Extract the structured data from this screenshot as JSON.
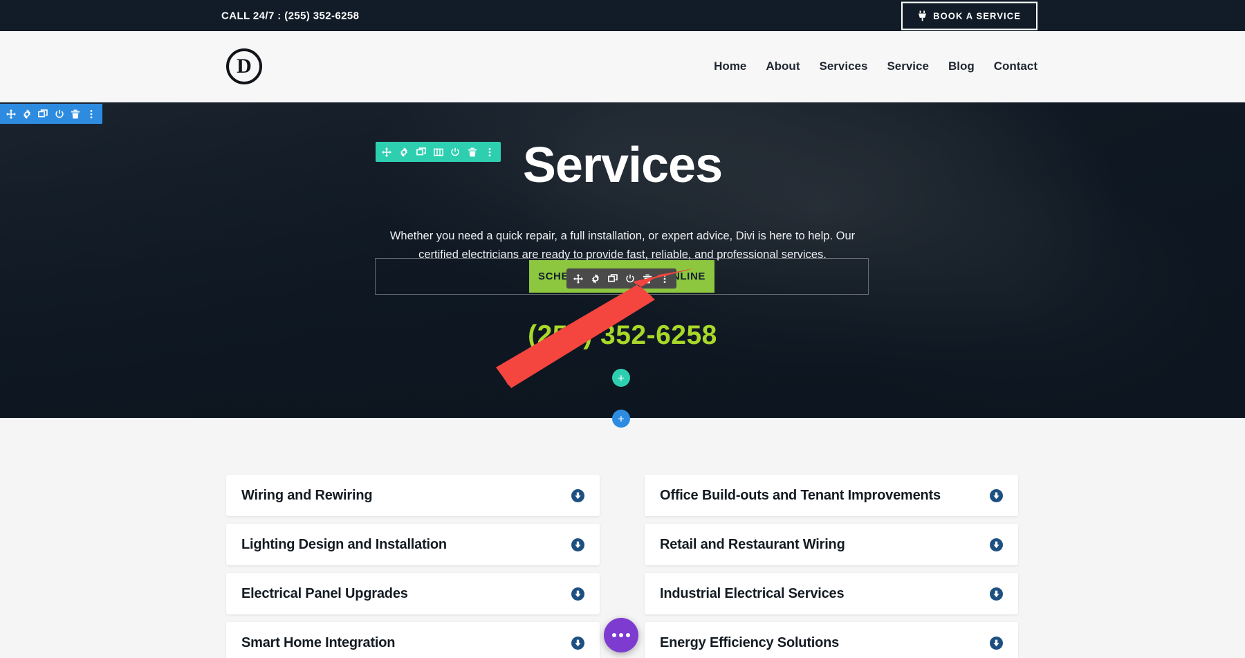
{
  "topbar": {
    "phone_label": "CALL 24/7 : (255) 352-6258",
    "book_button": "BOOK A SERVICE",
    "plug_icon": "plug-icon",
    "background_color": "#121c28"
  },
  "nav": {
    "logo_letter": "D",
    "items": [
      {
        "label": "Home"
      },
      {
        "label": "About"
      },
      {
        "label": "Services"
      },
      {
        "label": "Service"
      },
      {
        "label": "Blog"
      },
      {
        "label": "Contact"
      }
    ]
  },
  "hero": {
    "title": "Services",
    "subtitle": "Whether you need a quick repair, a full installation, or expert advice, Divi is here to help. Our certified electricians are ready to provide fast, reliable, and professional services.",
    "cta_button": "SCHEDULE A SERVICE ONLINE",
    "cta_color": "#8dc63f",
    "phone": "(255) 352-6258",
    "phone_color": "#a8d82a"
  },
  "builder": {
    "section_toolbar": {
      "color": "#2d8ce0",
      "buttons": [
        {
          "name": "move-icon",
          "title": "Move Section"
        },
        {
          "name": "gear-icon",
          "title": "Section Settings"
        },
        {
          "name": "duplicate-icon",
          "title": "Duplicate Section"
        },
        {
          "name": "power-icon",
          "title": "Disable Section"
        },
        {
          "name": "trash-icon",
          "title": "Delete Section"
        },
        {
          "name": "kebab-menu-icon",
          "title": "More Options"
        }
      ]
    },
    "row_toolbar": {
      "color": "#2ecfb0",
      "buttons": [
        {
          "name": "move-icon",
          "title": "Move Row"
        },
        {
          "name": "gear-icon",
          "title": "Row Settings"
        },
        {
          "name": "duplicate-icon",
          "title": "Duplicate Row"
        },
        {
          "name": "columns-icon",
          "title": "Change Column Structure"
        },
        {
          "name": "power-icon",
          "title": "Disable Row"
        },
        {
          "name": "trash-icon",
          "title": "Delete Row"
        },
        {
          "name": "kebab-menu-icon",
          "title": "More Options"
        }
      ]
    },
    "module_toolbar": {
      "color": "#4a4a4a",
      "buttons": [
        {
          "name": "move-icon",
          "title": "Move Module"
        },
        {
          "name": "gear-icon",
          "title": "Module Settings"
        },
        {
          "name": "duplicate-icon",
          "title": "Duplicate Module"
        },
        {
          "name": "power-icon",
          "title": "Disable Module"
        },
        {
          "name": "trash-icon",
          "title": "Delete Module"
        },
        {
          "name": "kebab-menu-icon",
          "title": "More Options"
        }
      ]
    },
    "add_buttons": [
      {
        "name": "add-module-button",
        "glyph": "+",
        "color": "#7b7b7b"
      },
      {
        "name": "add-row-button",
        "glyph": "+",
        "color": "#2ecfb0"
      },
      {
        "name": "add-section-button",
        "glyph": "+",
        "color": "#2d8ce0"
      }
    ],
    "fab": {
      "name": "builder-menu-fab",
      "color": "#7e3bd0"
    },
    "annotation": {
      "name": "red-arrow-annotation",
      "color": "#f4453f"
    }
  },
  "accordion": {
    "items": [
      {
        "label": "Wiring and Rewiring",
        "icon": "circle-arrow-down-icon"
      },
      {
        "label": "Office Build-outs and Tenant Improvements",
        "icon": "circle-arrow-down-icon"
      },
      {
        "label": "Lighting Design and Installation",
        "icon": "circle-arrow-down-icon"
      },
      {
        "label": "Retail and Restaurant Wiring",
        "icon": "circle-arrow-down-icon"
      },
      {
        "label": "Electrical Panel Upgrades",
        "icon": "circle-arrow-down-icon"
      },
      {
        "label": "Industrial Electrical Services",
        "icon": "circle-arrow-down-icon"
      },
      {
        "label": "Smart Home Integration",
        "icon": "circle-arrow-down-icon"
      },
      {
        "label": "Energy Efficiency Solutions",
        "icon": "circle-arrow-down-icon"
      }
    ],
    "icon_color": "#1d5080"
  }
}
